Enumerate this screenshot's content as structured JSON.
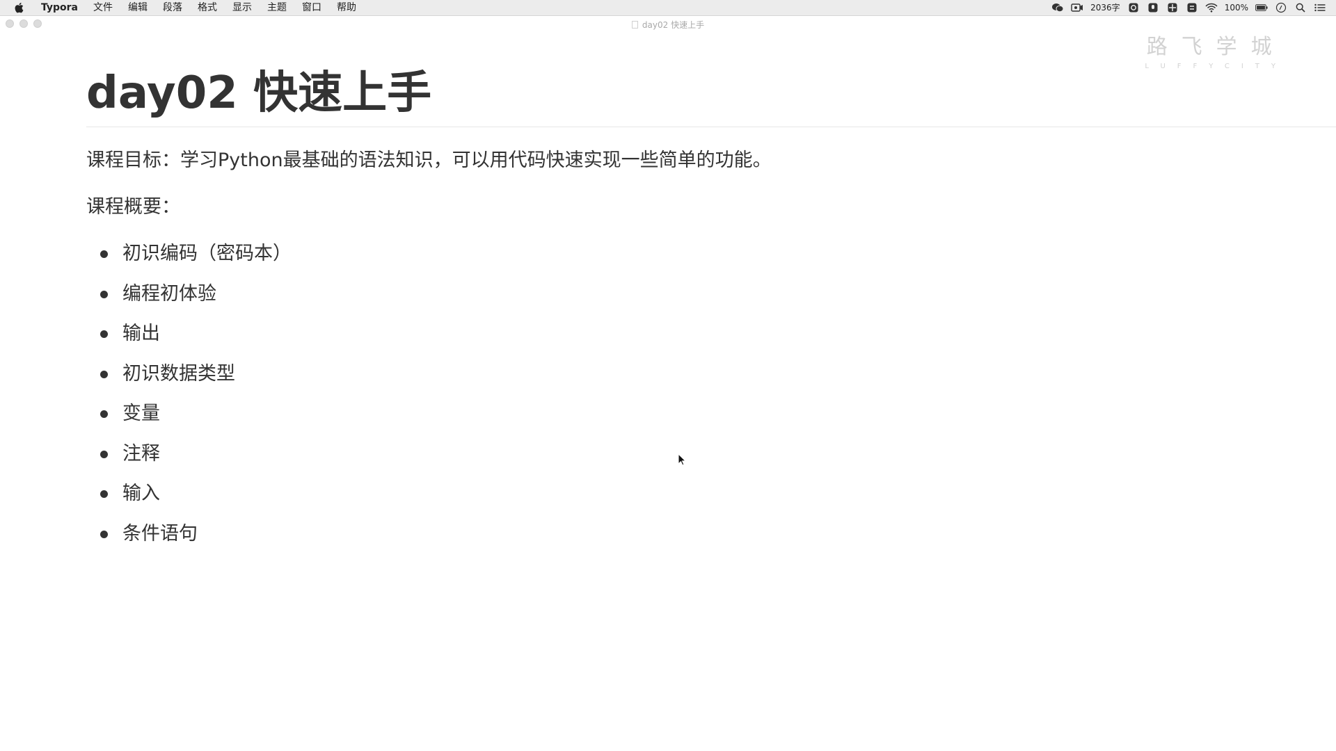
{
  "menubar": {
    "app_name": "Typora",
    "items": [
      "文件",
      "编辑",
      "段落",
      "格式",
      "显示",
      "主题",
      "窗口",
      "帮助"
    ],
    "word_count": "2036字",
    "battery": "100%"
  },
  "window": {
    "title": "day02 快速上手"
  },
  "watermark": {
    "cn": "路飞学城",
    "en": "LUFFYCITY"
  },
  "document": {
    "heading": "day02 快速上手",
    "goal": "课程目标：学习Python最基础的语法知识，可以用代码快速实现一些简单的功能。",
    "overview_label": "课程概要：",
    "outline": [
      "初识编码（密码本）",
      "编程初体验",
      "输出",
      "初识数据类型",
      "变量",
      "注释",
      "输入",
      "条件语句"
    ]
  }
}
